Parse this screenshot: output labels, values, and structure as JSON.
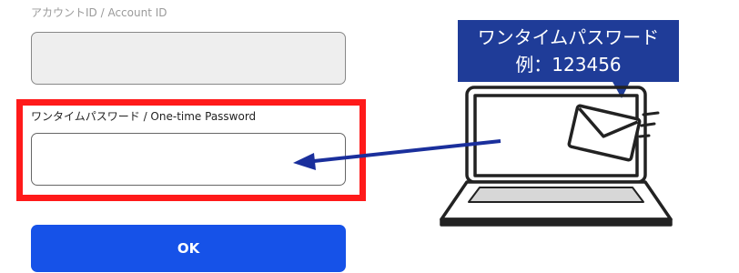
{
  "account": {
    "label": "アカウントID / Account ID"
  },
  "otp": {
    "label": "ワンタイムパスワード / One-time Password",
    "value": ""
  },
  "ok_button": {
    "label": "OK"
  },
  "callout": {
    "line1": "ワンタイムパスワード",
    "line2": "例：123456"
  },
  "colors": {
    "highlight": "#ff1a1a",
    "button": "#1652e8",
    "callout": "#1f3c98",
    "arrow": "#1a2f9c"
  },
  "icons": [
    "laptop-icon",
    "envelope-icon",
    "arrow-icon"
  ]
}
